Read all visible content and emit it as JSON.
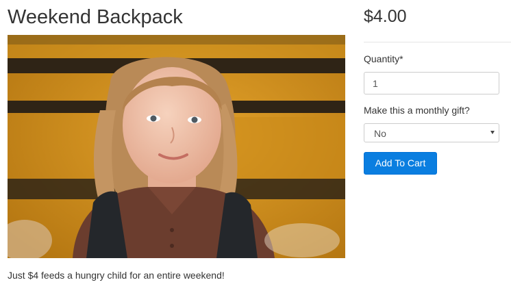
{
  "product": {
    "title": "Weekend Backpack",
    "description": "Just $4 feeds a hungry child for an entire weekend!",
    "image_icon": "product-photo-child-with-backpack"
  },
  "purchase": {
    "price": "$4.00",
    "quantity_label": "Quantity*",
    "quantity_value": "1",
    "gift_label": "Make this a monthly gift?",
    "gift_selected": "No",
    "add_to_cart_label": "Add To Cart",
    "accent_color": "#0a7ee0"
  }
}
